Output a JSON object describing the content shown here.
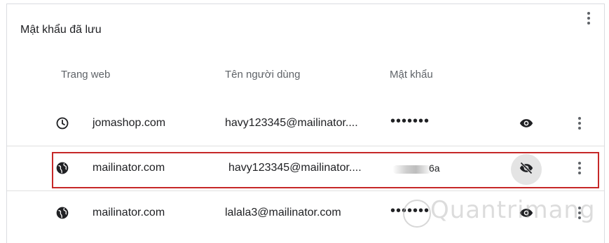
{
  "section": {
    "title": "Mật khẩu đã lưu"
  },
  "columns": {
    "site": "Trang web",
    "username": "Tên người dùng",
    "password": "Mật khẩu"
  },
  "rows": [
    {
      "site": "jomashop.com",
      "username": "havy123345@mailinator....",
      "password": "•••••••",
      "icon": "history-icon",
      "password_visible": false
    },
    {
      "site": "mailinator.com",
      "username": "havy123345@mailinator....",
      "password": "6a",
      "icon": "globe-icon",
      "password_visible": true
    },
    {
      "site": "mailinator.com",
      "username": "lalala3@mailinator.com",
      "password": "•••••••",
      "icon": "globe-icon",
      "password_visible": false
    }
  ],
  "watermark": "Quantrimang"
}
